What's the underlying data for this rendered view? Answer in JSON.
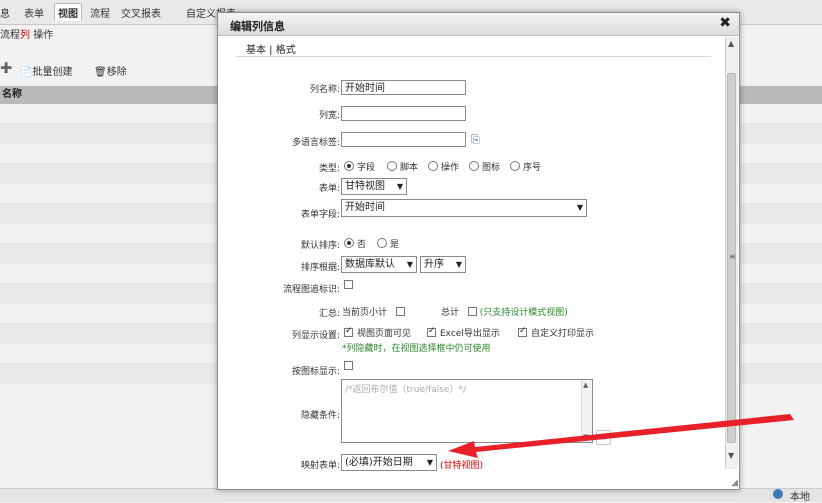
{
  "background": {
    "tabs": [
      "息",
      "表单",
      "视图",
      "流程",
      "交叉报表",
      "自定义报表"
    ],
    "active_tab": "视图",
    "sub_crumbs": {
      "prefix": "流程",
      "active": "列",
      "suffix": "操作"
    },
    "toolbar": {
      "batch_create": "批量创建",
      "remove": "移除"
    },
    "table_header": "名称",
    "status_text": "本地"
  },
  "dialog": {
    "title": "编辑列信息",
    "close": "✖",
    "section_tabs": "基本 | 格式",
    "fields": {
      "column_name": {
        "label": "列名称:",
        "value": "开始时间"
      },
      "column_width": {
        "label": "列宽:",
        "value": ""
      },
      "i18n_label": {
        "label": "多语言标签:",
        "value": ""
      },
      "type": {
        "label": "类型:",
        "options": [
          "字段",
          "脚本",
          "操作",
          "图标",
          "序号"
        ],
        "selected": "字段"
      },
      "form": {
        "label": "表单:",
        "value": "甘特视图"
      },
      "form_field": {
        "label": "表单字段:",
        "value": "开始时间"
      },
      "default_sort": {
        "label": "默认排序:",
        "options": [
          "否",
          "是"
        ],
        "selected": "否"
      },
      "sort_basis": {
        "label": "排序根据:",
        "value": "数据库默认",
        "order": "升序"
      },
      "flow_icon": {
        "label": "流程图追标识:"
      },
      "summary": {
        "label": "汇总:",
        "current_page": "当前页小计",
        "total": "总计",
        "note": "(只支持设计模式视图)"
      },
      "display": {
        "label": "列显示设置:",
        "options": [
          "视图页面可见",
          "Excel导出显示",
          "自定义打印显示"
        ],
        "note": "*列隐藏时，在视图选择框中仍可使用"
      },
      "icon_display": {
        "label": "按图标显示:"
      },
      "hide_condition": {
        "label": "隐藏条件:",
        "placeholder": "/*返回布尔值（true/false）*/"
      },
      "mapping_form": {
        "label": "映射表单:",
        "value": "(必填)开始日期",
        "note": "(甘特视图)"
      }
    }
  },
  "colors": {
    "annotation_arrow": "#e8202a",
    "green_note": "#2a8a2a",
    "header_bg": "#b9b9b9"
  }
}
